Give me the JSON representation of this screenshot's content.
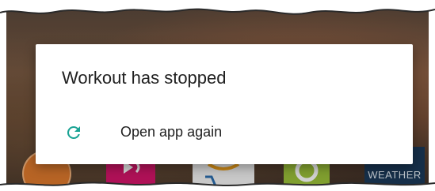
{
  "dialog": {
    "title": "Workout has stopped",
    "options": [
      {
        "label": "Open app again",
        "icon": "refresh-icon"
      }
    ]
  },
  "background": {
    "dock": [
      {
        "icon": "orange-app-icon"
      },
      {
        "icon": "pink-media-icon"
      },
      {
        "icon": "amazon-cart-icon"
      },
      {
        "icon": "green-app-icon"
      },
      {
        "icon": "weather-app-icon",
        "label": "WEATHER"
      }
    ]
  },
  "colors": {
    "accent": "#1aa394",
    "dialog_bg": "#ffffff",
    "title_text": "#212121"
  }
}
